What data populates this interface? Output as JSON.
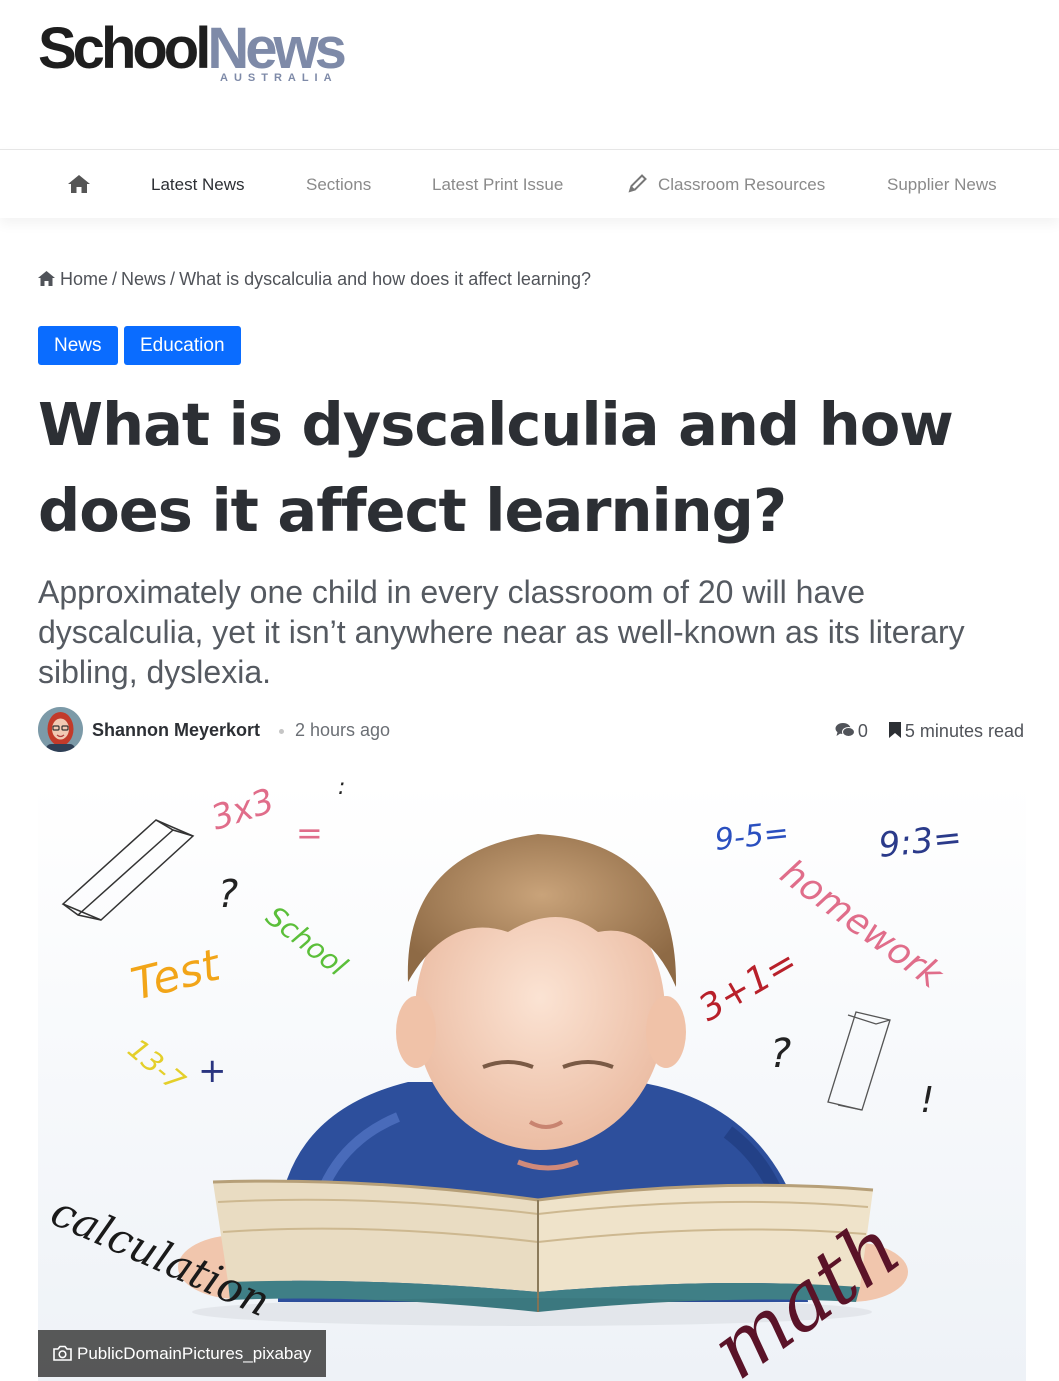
{
  "logo": {
    "part1": "School",
    "part2": "News",
    "sub": "AUSTRALIA"
  },
  "nav": {
    "items": [
      {
        "label": "Latest News",
        "active": true
      },
      {
        "label": "Sections",
        "active": false
      },
      {
        "label": "Latest Print Issue",
        "active": false
      },
      {
        "label": "Classroom Resources",
        "active": false,
        "icon": "pencil-icon"
      },
      {
        "label": "Supplier News",
        "active": false
      }
    ],
    "home_icon": "home-icon"
  },
  "breadcrumb": {
    "home": "Home",
    "section": "News",
    "current": "What is dyscalculia and how does it affect learning?",
    "separator": "/"
  },
  "tags": [
    "News",
    "Education"
  ],
  "article": {
    "title": "What is dyscalculia and how does it affect learning?",
    "subtitle": "Approximately one child in every classroom of 20 will have dyscalculia, yet it isn’t anywhere near as well-known as its literary sibling, dyslexia.",
    "author": "Shannon Meyerkort",
    "time": "2 hours ago",
    "comments": "0",
    "read_time": "5 minutes read"
  },
  "hero": {
    "caption": "PublicDomainPictures_pixabay",
    "scribbles": {
      "s1": "3x3",
      "s2": "=",
      "s3": "?",
      "s4": "School",
      "s5": "Test",
      "s6": "13-7",
      "s7": "+",
      "s8": "9-5=",
      "s9": "9:3=",
      "s10": "homework",
      "s11": "3+1=",
      "s12": "?",
      "s13": "!",
      "s14": "calculation",
      "s15": "math",
      "s16": ":"
    }
  },
  "colors": {
    "accent": "#0a6cff",
    "logo_news": "#7e8aa8",
    "text": "#2c2f34"
  }
}
